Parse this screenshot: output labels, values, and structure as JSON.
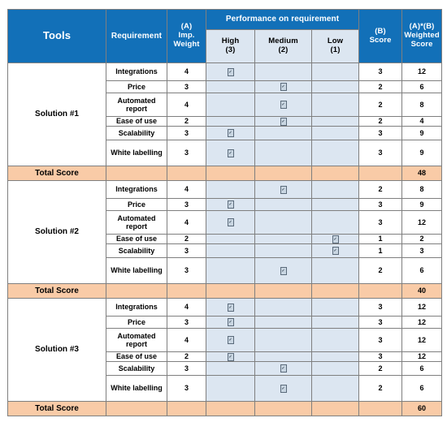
{
  "header": {
    "tools": "Tools",
    "requirement": "Requirement",
    "imp_weight": "(A)\nImp.\nWeight",
    "imp_weight_l1": "(A)",
    "imp_weight_l2": "Imp.",
    "imp_weight_l3": "Weight",
    "performance_group": "Performance on requirement",
    "perf_high_l1": "High",
    "perf_high_l2": "(3)",
    "perf_medium_l1": "Medium",
    "perf_medium_l2": "(2)",
    "perf_low_l1": "Low",
    "perf_low_l2": "(1)",
    "score_l1": "(B)",
    "score_l2": "Score",
    "weighted_l1": "(A)*(B)",
    "weighted_l2": "Weighted",
    "weighted_l3": "Score"
  },
  "labels": {
    "total_score": "Total Score",
    "check_mark": "✓"
  },
  "colors": {
    "header_blue": "#1270B8",
    "subheader_blue": "#DCE6F1",
    "performance_blue": "#DCE6F1",
    "total_peach": "#F9CBA7",
    "border_gray": "#7f7f7f"
  },
  "chart_data": {
    "type": "table",
    "title": "Weighted scoring matrix for tool selection",
    "columns": [
      "Tools",
      "Requirement",
      "(A) Imp. Weight",
      "High (3)",
      "Medium (2)",
      "Low (1)",
      "(B) Score",
      "(A)*(B) Weighted Score"
    ],
    "solutions": [
      {
        "name": "Solution #1",
        "total_score": 48,
        "rows": [
          {
            "requirement": "Integrations",
            "weight": 4,
            "performance": "high",
            "score": 3,
            "weighted": 12
          },
          {
            "requirement": "Price",
            "weight": 3,
            "performance": "medium",
            "score": 2,
            "weighted": 6
          },
          {
            "requirement": "Automated report",
            "weight": 4,
            "performance": "medium",
            "score": 2,
            "weighted": 8
          },
          {
            "requirement": "Ease of use",
            "weight": 2,
            "performance": "medium",
            "score": 2,
            "weighted": 4
          },
          {
            "requirement": "Scalability",
            "weight": 3,
            "performance": "high",
            "score": 3,
            "weighted": 9
          },
          {
            "requirement": "White labelling",
            "weight": 3,
            "performance": "high",
            "score": 3,
            "weighted": 9
          }
        ]
      },
      {
        "name": "Solution #2",
        "total_score": 40,
        "rows": [
          {
            "requirement": "Integrations",
            "weight": 4,
            "performance": "medium",
            "score": 2,
            "weighted": 8
          },
          {
            "requirement": "Price",
            "weight": 3,
            "performance": "high",
            "score": 3,
            "weighted": 9
          },
          {
            "requirement": "Automated report",
            "weight": 4,
            "performance": "high",
            "score": 3,
            "weighted": 12
          },
          {
            "requirement": "Ease of use",
            "weight": 2,
            "performance": "low",
            "score": 1,
            "weighted": 2
          },
          {
            "requirement": "Scalability",
            "weight": 3,
            "performance": "low",
            "score": 1,
            "weighted": 3
          },
          {
            "requirement": "White labelling",
            "weight": 3,
            "performance": "medium",
            "score": 2,
            "weighted": 6
          }
        ]
      },
      {
        "name": "Solution #3",
        "total_score": 60,
        "rows": [
          {
            "requirement": "Integrations",
            "weight": 4,
            "performance": "high",
            "score": 3,
            "weighted": 12
          },
          {
            "requirement": "Price",
            "weight": 3,
            "performance": "high",
            "score": 3,
            "weighted": 12
          },
          {
            "requirement": "Automated report",
            "weight": 4,
            "performance": "high",
            "score": 3,
            "weighted": 12
          },
          {
            "requirement": "Ease of use",
            "weight": 2,
            "performance": "high",
            "score": 3,
            "weighted": 12
          },
          {
            "requirement": "Scalability",
            "weight": 3,
            "performance": "medium",
            "score": 2,
            "weighted": 6
          },
          {
            "requirement": "White labelling",
            "weight": 3,
            "performance": "medium",
            "score": 2,
            "weighted": 6
          }
        ]
      }
    ]
  }
}
